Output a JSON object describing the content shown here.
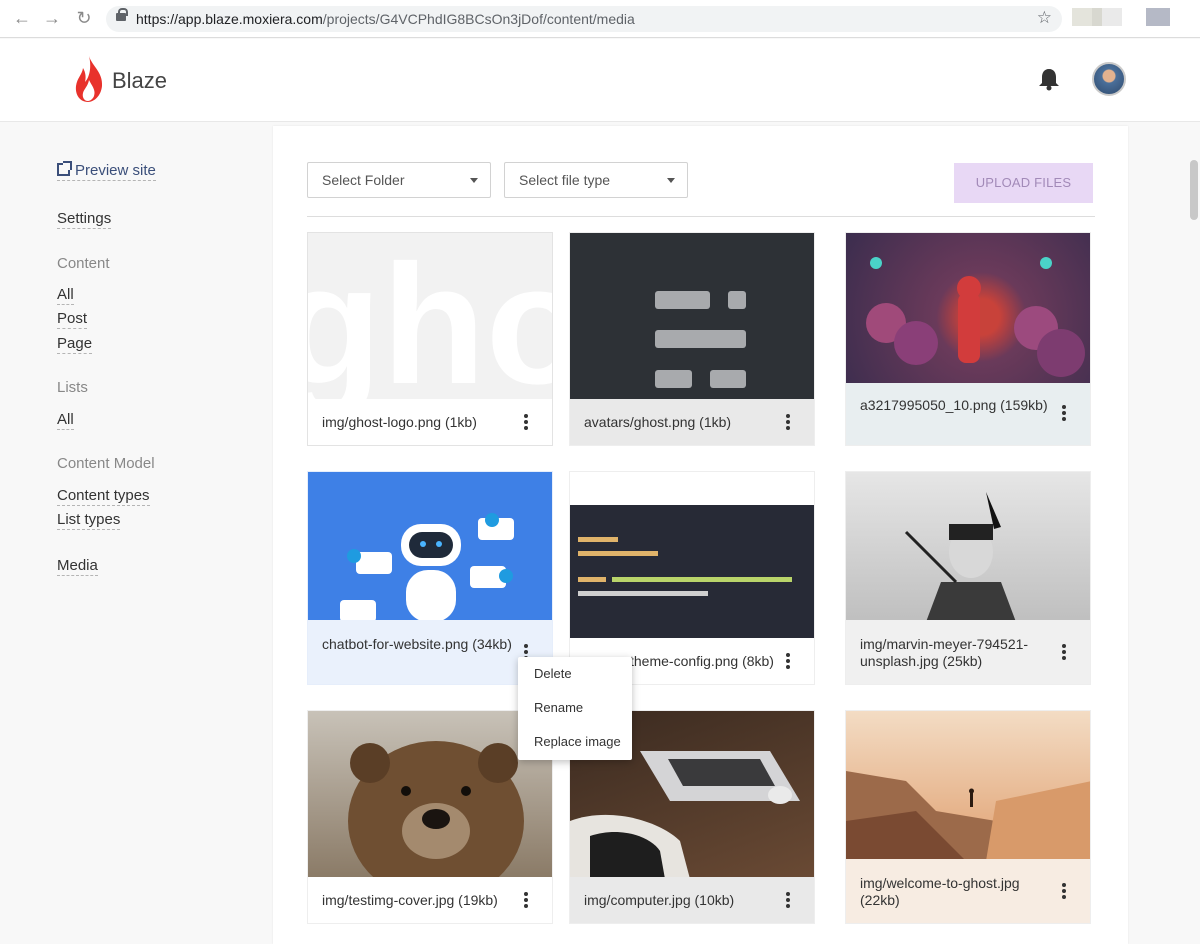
{
  "browser": {
    "url_host": "https://app.blaze.moxiera.com",
    "url_path": "/projects/G4VCPhdIG8BCsOn3jDof/content/media"
  },
  "header": {
    "brand": "Blaze",
    "colors": {
      "flame": "#e8322c",
      "flame_inner": "#f6a33d"
    }
  },
  "sidebar": {
    "preview": "Preview site",
    "settings": "Settings",
    "content_heading": "Content",
    "content_all": "All",
    "content_post": "Post",
    "content_page": "Page",
    "lists_heading": "Lists",
    "lists_all": "All",
    "model_heading": "Content Model",
    "content_types": "Content types",
    "list_types": "List types",
    "media": "Media"
  },
  "toolbar": {
    "folder_select": "Select Folder",
    "filetype_select": "Select file type",
    "upload_label": "UPLOAD FILES",
    "upload_color": "#e8d8f5"
  },
  "media": [
    {
      "caption": "img/ghost-logo.png (1kb)",
      "thumb": "ghost-logo"
    },
    {
      "caption": "avatars/ghost.png (1kb)",
      "thumb": "ghost-avatar"
    },
    {
      "caption": "a3217995050_10.png (159kb)",
      "thumb": "colorful-illustration"
    },
    {
      "caption": "chatbot-for-website.png (34kb)",
      "thumb": "chatbot"
    },
    {
      "caption": "theme-config.png (8kb)",
      "thumb": "code-screenshot"
    },
    {
      "caption": "img/marvin-meyer-794521-unsplash.jpg (25kb)",
      "thumb": "bw-portrait"
    },
    {
      "caption": "img/testimg-cover.jpg (19kb)",
      "thumb": "bear"
    },
    {
      "caption": "img/computer.jpg (10kb)",
      "thumb": "laptop"
    },
    {
      "caption": "img/welcome-to-ghost.jpg (22kb)",
      "thumb": "canyon"
    }
  ],
  "context_menu": {
    "delete": "Delete",
    "rename": "Rename",
    "replace": "Replace image"
  }
}
